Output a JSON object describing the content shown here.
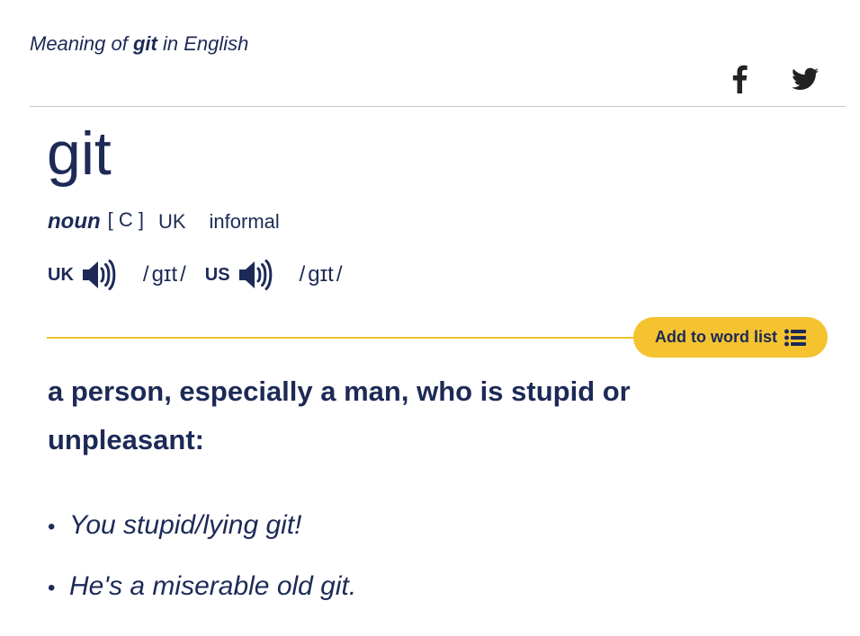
{
  "header": {
    "prefix": "Meaning of ",
    "word": "git",
    "suffix": " in English"
  },
  "share": {
    "facebook_icon": "facebook-icon",
    "twitter_icon": "twitter-icon"
  },
  "entry": {
    "headword": "git",
    "part_of_speech": "noun",
    "grammar_code": "[ C ]",
    "region": "UK",
    "register": "informal"
  },
  "pronunciations": [
    {
      "region": "UK",
      "ipa": "gɪt",
      "icon": "speaker-icon"
    },
    {
      "region": "US",
      "ipa": "gɪt",
      "icon": "speaker-icon"
    }
  ],
  "word_list_button": {
    "label": "Add to word list",
    "icon": "list-icon"
  },
  "definition": "a person, especially a man, who is stupid or unpleasant:",
  "examples": [
    "You stupid/lying git!",
    "He's a miserable old git."
  ],
  "colors": {
    "text": "#1d2a57",
    "accent": "#f5c330",
    "divider": "#c9c9c9"
  }
}
